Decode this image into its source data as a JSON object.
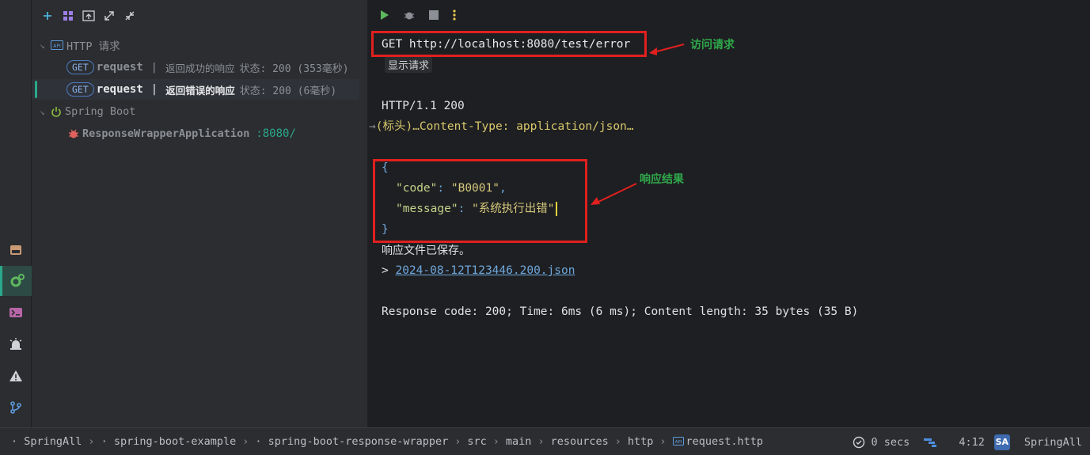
{
  "services": {
    "toolbar_icons": [
      "add-icon",
      "group-icon",
      "new-tab-icon",
      "expand-all-icon",
      "collapse-all-icon"
    ],
    "http_group": {
      "label": "HTTP 请求"
    },
    "requests": [
      {
        "method": "GET",
        "name": "request",
        "separator": "|",
        "title": "返回成功的响应",
        "status": "状态: 200 (353毫秒)"
      },
      {
        "method": "GET",
        "name": "request",
        "separator": "|",
        "title": "返回错误的响应",
        "status": "状态: 200 (6毫秒)"
      }
    ],
    "spring_group": {
      "label": "Spring Boot"
    },
    "app": {
      "name": "ResponseWrapperApplication",
      "port": ":8080/"
    }
  },
  "editor": {
    "request_line": "GET http://localhost:8080/test/error",
    "hint": "显示请求",
    "status_line": "HTTP/1.1 200",
    "headers_line": "(标头)…Content-Type: application/json…",
    "json_open": "{",
    "code_key": "\"code\"",
    "code_val": "\"B0001\"",
    "message_key": "\"message\"",
    "message_val": "\"系统执行出错\"",
    "json_close": "}",
    "saved_text": "响应文件已保存。",
    "file_prefix": ">",
    "file_link": "2024-08-12T123446.200.json",
    "summary": "Response code: 200; Time: 6ms (6 ms); Content length: 35 bytes (35 B)"
  },
  "annotations": {
    "request_label": "访问请求",
    "response_label": "响应结果",
    "color": "#e0201e",
    "text_color": "#2fa84a"
  },
  "statusbar": {
    "breadcrumbs": [
      "SpringAll",
      "spring-boot-example",
      "spring-boot-response-wrapper",
      "src",
      "main",
      "resources",
      "http",
      "request.http"
    ],
    "time": "0 secs",
    "position": "4:12",
    "avatar": "SA",
    "project": "SpringAll"
  },
  "colors": {
    "accent": "#2aa88a",
    "background": "#1e1f22",
    "panel": "#2b2d30"
  }
}
